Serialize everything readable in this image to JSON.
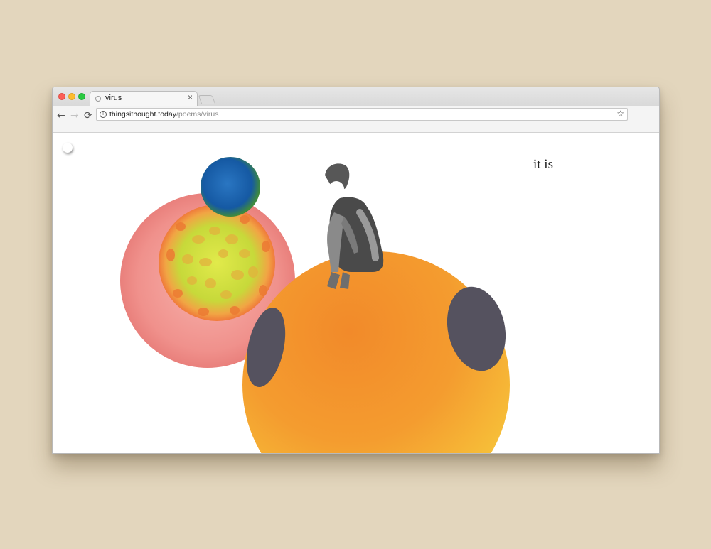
{
  "browser": {
    "tab_title": "virus",
    "tab_close": "×",
    "url_host": "thingsithought.today",
    "url_path": "/poems/virus",
    "info_glyph": "i",
    "star_glyph": "☆",
    "back_glyph": "←",
    "forward_glyph": "→",
    "reload_glyph": "⟳",
    "traffic_lights": [
      "#fc5f57",
      "#fdbc2e",
      "#29c940"
    ]
  },
  "page": {
    "poem_line": "it is",
    "background": "#ffffff"
  },
  "colors": {
    "desk": "#e3d6bd",
    "pink_cell": "#f08a86",
    "green_core": "#cfe03a",
    "blue_planet": "#1a5fa8",
    "orange_planet": "#f39a2c",
    "crater": "#55525f"
  }
}
